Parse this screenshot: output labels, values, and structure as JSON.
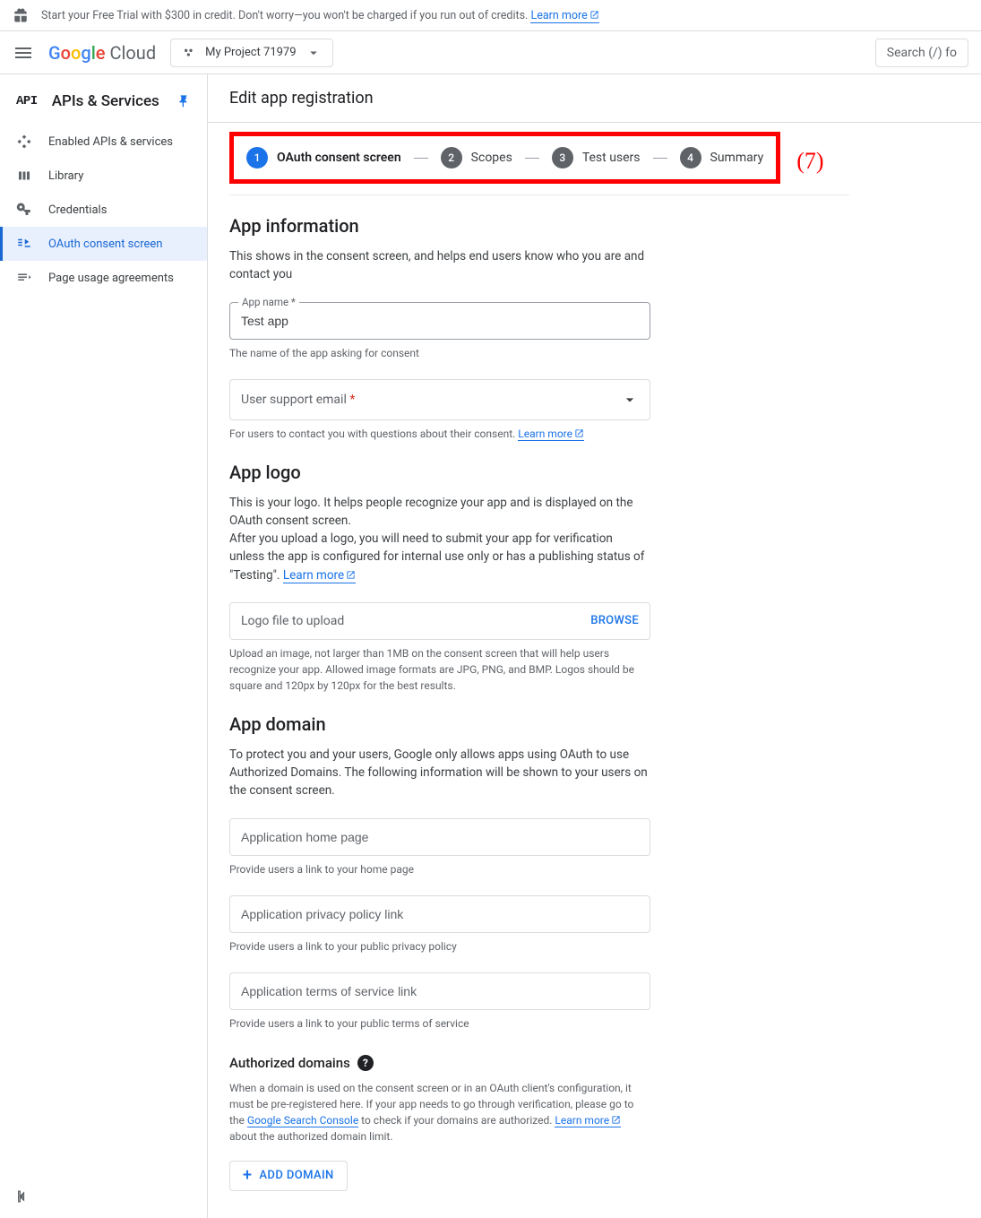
{
  "banner": {
    "text": "Start your Free Trial with $300 in credit. Don't worry—you won't be charged if you run out of credits.",
    "link": "Learn more"
  },
  "header": {
    "logo_cloud": "Cloud",
    "project": "My Project 71979",
    "search_placeholder": "Search (/) fo"
  },
  "sidebar": {
    "api_badge": "API",
    "title": "APIs & Services",
    "items": [
      {
        "label": "Enabled APIs & services"
      },
      {
        "label": "Library"
      },
      {
        "label": "Credentials"
      },
      {
        "label": "OAuth consent screen"
      },
      {
        "label": "Page usage agreements"
      }
    ]
  },
  "page": {
    "title": "Edit app registration",
    "stepper": [
      {
        "num": "1",
        "label": "OAuth consent screen"
      },
      {
        "num": "2",
        "label": "Scopes"
      },
      {
        "num": "3",
        "label": "Test users"
      },
      {
        "num": "4",
        "label": "Summary"
      }
    ],
    "annotation": "(7)",
    "app_info": {
      "heading": "App information",
      "desc": "This shows in the consent screen, and helps end users know who you are and contact you",
      "app_name_label": "App name *",
      "app_name_value": "Test app",
      "app_name_hint": "The name of the app asking for consent",
      "support_email_placeholder": "User support email",
      "support_email_hint": "For users to contact you with questions about their consent.",
      "learn_more": "Learn more"
    },
    "app_logo": {
      "heading": "App logo",
      "desc1": "This is your logo. It helps people recognize your app and is displayed on the OAuth consent screen.",
      "desc2": "After you upload a logo, you will need to submit your app for verification unless the app is configured for internal use only or has a publishing status of \"Testing\".",
      "learn_more": "Learn more",
      "file_placeholder": "Logo file to upload",
      "browse": "BROWSE",
      "file_hint": "Upload an image, not larger than 1MB on the consent screen that will help users recognize your app. Allowed image formats are JPG, PNG, and BMP. Logos should be square and 120px by 120px for the best results."
    },
    "app_domain": {
      "heading": "App domain",
      "desc": "To protect you and your users, Google only allows apps using OAuth to use Authorized Domains. The following information will be shown to your users on the consent screen.",
      "home_placeholder": "Application home page",
      "home_hint": "Provide users a link to your home page",
      "privacy_placeholder": "Application privacy policy link",
      "privacy_hint": "Provide users a link to your public privacy policy",
      "tos_placeholder": "Application terms of service link",
      "tos_hint": "Provide users a link to your public terms of service"
    },
    "auth_domains": {
      "heading": "Authorized domains",
      "desc_pre": "When a domain is used on the consent screen or in an OAuth client's configuration, it must be pre-registered here. If your app needs to go through verification, please go to the",
      "link1": "Google Search Console",
      "desc_mid": "to check if your domains are authorized.",
      "link2": "Learn more",
      "desc_post": "about the authorized domain limit.",
      "add_button": "ADD DOMAIN"
    }
  }
}
